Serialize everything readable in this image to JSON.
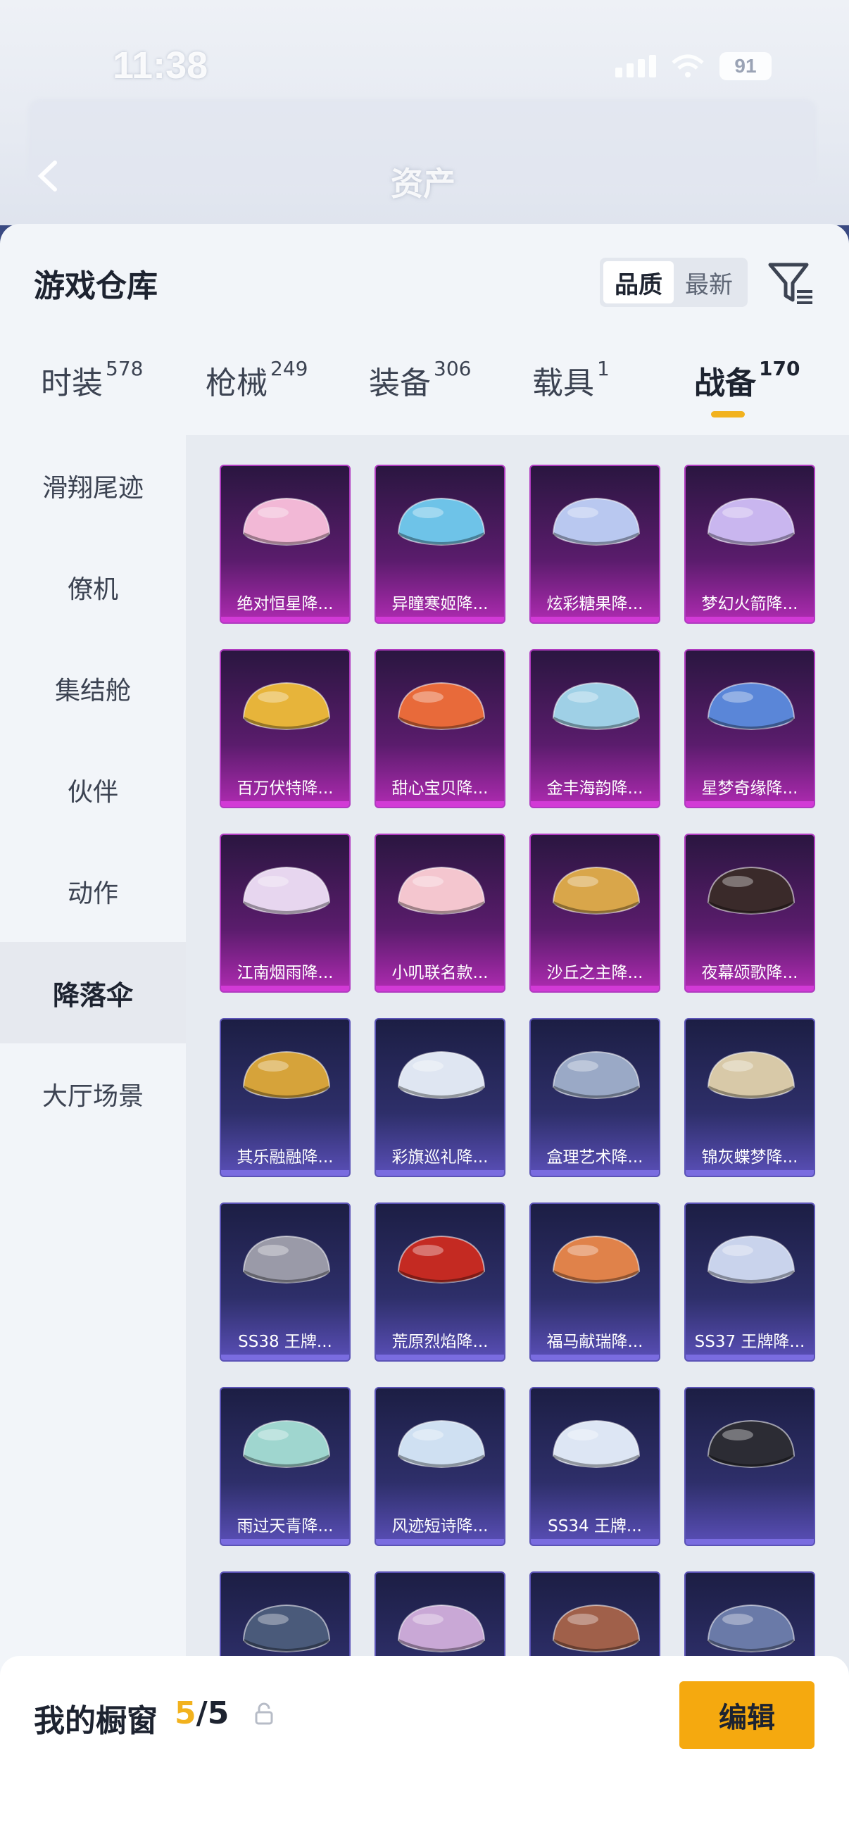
{
  "status_bar": {
    "time": "11:38",
    "battery": "91"
  },
  "header": {
    "title": "资产"
  },
  "sheet": {
    "title": "游戏仓库",
    "sort": {
      "options": [
        "品质",
        "最新"
      ],
      "selected": "品质"
    },
    "tabs": [
      {
        "label": "时装",
        "count": "578"
      },
      {
        "label": "枪械",
        "count": "249"
      },
      {
        "label": "装备",
        "count": "306"
      },
      {
        "label": "载具",
        "count": "1"
      },
      {
        "label": "战备",
        "count": "170",
        "active": true
      }
    ],
    "sidebar": [
      {
        "label": "滑翔尾迹"
      },
      {
        "label": "僚机"
      },
      {
        "label": "集结舱"
      },
      {
        "label": "伙伴"
      },
      {
        "label": "动作"
      },
      {
        "label": "降落伞",
        "active": true
      },
      {
        "label": "大厅场景"
      }
    ],
    "items": [
      {
        "name": "绝对恒星降...",
        "tier": "pink",
        "color": "#f2b8d6"
      },
      {
        "name": "异瞳寒姬降...",
        "tier": "pink",
        "color": "#6ec3e8"
      },
      {
        "name": "炫彩糖果降...",
        "tier": "pink",
        "color": "#b9c8f0"
      },
      {
        "name": "梦幻火箭降...",
        "tier": "pink",
        "color": "#c9b6ef"
      },
      {
        "name": "百万伏特降...",
        "tier": "pink",
        "color": "#e7b43a"
      },
      {
        "name": "甜心宝贝降...",
        "tier": "pink",
        "color": "#e86a3a"
      },
      {
        "name": "金丰海韵降...",
        "tier": "pink",
        "color": "#9fd0e6"
      },
      {
        "name": "星梦奇缘降...",
        "tier": "pink",
        "color": "#5a86d8"
      },
      {
        "name": "江南烟雨降...",
        "tier": "pink",
        "color": "#e7d6ef"
      },
      {
        "name": "小叽联名款...",
        "tier": "pink",
        "color": "#f4c6cf"
      },
      {
        "name": "沙丘之主降...",
        "tier": "pink",
        "color": "#d9a64a"
      },
      {
        "name": "夜幕颂歌降...",
        "tier": "pink",
        "color": "#3a2a2a"
      },
      {
        "name": "其乐融融降...",
        "tier": "purple",
        "color": "#d6a33a"
      },
      {
        "name": "彩旗巡礼降...",
        "tier": "purple",
        "color": "#dfe6f2"
      },
      {
        "name": "盒理艺术降...",
        "tier": "purple",
        "color": "#9aa9c6"
      },
      {
        "name": "锦灰蝶梦降...",
        "tier": "purple",
        "color": "#d8c9a8"
      },
      {
        "name": "SS38 王牌...",
        "tier": "purple",
        "color": "#9a9aa8"
      },
      {
        "name": "荒原烈焰降...",
        "tier": "purple",
        "color": "#c42a22"
      },
      {
        "name": "福马献瑞降...",
        "tier": "purple",
        "color": "#e0824a"
      },
      {
        "name": "SS37 王牌降...",
        "tier": "purple",
        "color": "#c9d3ec"
      },
      {
        "name": "雨过天青降...",
        "tier": "purple",
        "color": "#9fd6cf"
      },
      {
        "name": "风迹短诗降...",
        "tier": "purple",
        "color": "#cfe0f2"
      },
      {
        "name": "SS34 王牌...",
        "tier": "purple",
        "color": "#dde6f4"
      },
      {
        "name": "",
        "tier": "purple",
        "color": "#2c2c34"
      },
      {
        "name": "",
        "tier": "purple",
        "color": "#4a5a7a"
      },
      {
        "name": "",
        "tier": "purple",
        "color": "#c9a8d6"
      },
      {
        "name": "",
        "tier": "purple",
        "color": "#a0604a"
      },
      {
        "name": "",
        "tier": "purple",
        "color": "#6a7aa8"
      }
    ]
  },
  "showcase": {
    "label": "我的橱窗",
    "current": "5",
    "total": "/5",
    "edit_label": "编辑"
  },
  "colors": {
    "accent": "#f5a90f",
    "pink_tier": "#b02bb2",
    "purple_tier": "#5a4fb8"
  }
}
